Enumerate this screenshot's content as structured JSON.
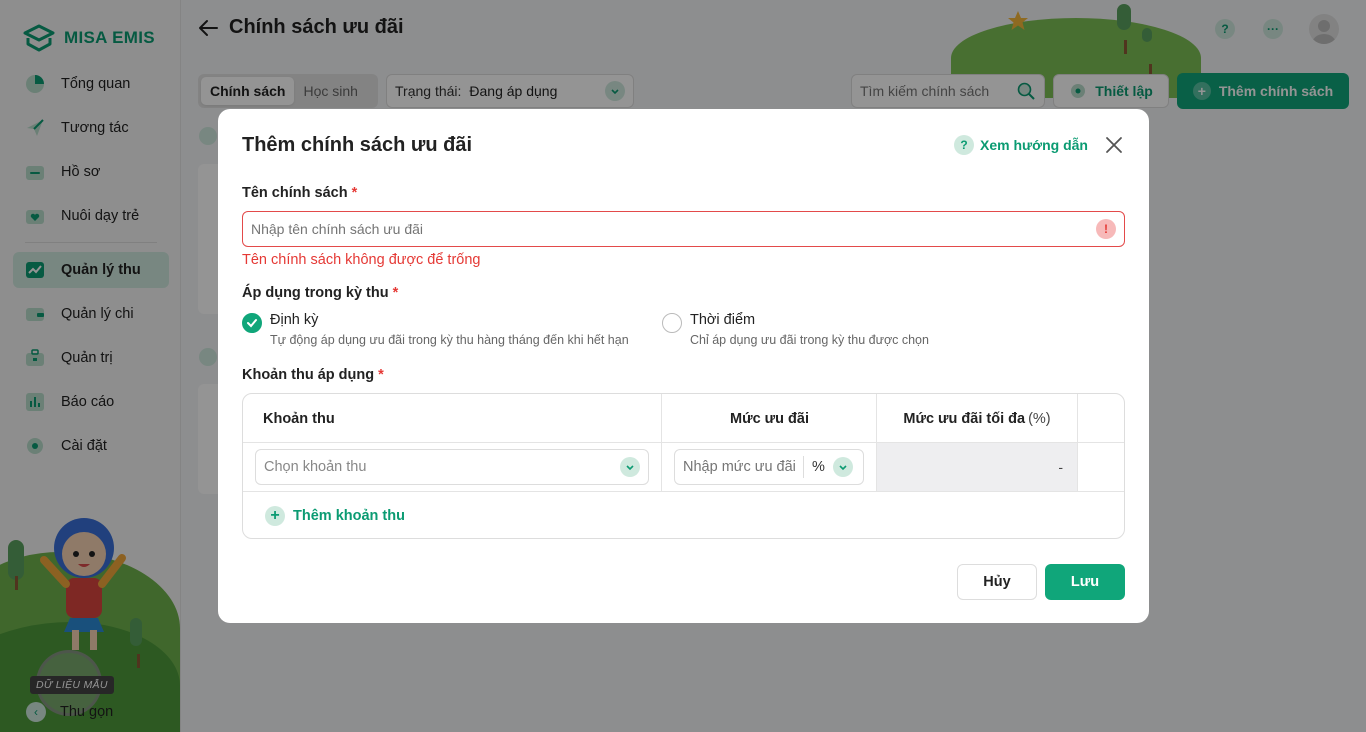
{
  "app": {
    "brand": "MISA EMIS"
  },
  "sidebar": {
    "items": [
      {
        "label": "Tổng quan",
        "icon": "pie-chart-icon"
      },
      {
        "label": "Tương tác",
        "icon": "paper-plane-icon"
      },
      {
        "label": "Hồ sơ",
        "icon": "folder-icon"
      },
      {
        "label": "Nuôi dạy trẻ",
        "icon": "heart-folder-icon"
      },
      {
        "label": "Quản lý thu",
        "icon": "trend-chart-icon",
        "active": true
      },
      {
        "label": "Quản lý chi",
        "icon": "wallet-icon"
      },
      {
        "label": "Quản trị",
        "icon": "briefcase-icon"
      },
      {
        "label": "Báo cáo",
        "icon": "bar-chart-icon"
      },
      {
        "label": "Cài đặt",
        "icon": "gear-icon"
      }
    ],
    "sample_badge": "DỮ LIỆU MẪU",
    "collapse_label": "Thu gọn"
  },
  "header": {
    "title": "Chính sách ưu đãi"
  },
  "toolbar": {
    "tabs": [
      "Chính sách",
      "Học sinh"
    ],
    "status_label": "Trạng thái:",
    "status_value": "Đang áp dụng",
    "search_placeholder": "Tìm kiếm chính sách",
    "setup_label": "Thiết lập",
    "add_label": "Thêm chính sách"
  },
  "modal": {
    "title": "Thêm chính sách ưu đãi",
    "help_label": "Xem hướng dẫn",
    "name_label": "Tên chính sách",
    "name_placeholder": "Nhập tên chính sách ưu đãi",
    "name_error": "Tên chính sách không được để trống",
    "period_label": "Áp dụng trong kỳ thu",
    "options": [
      {
        "title": "Định kỳ",
        "desc": "Tự động áp dụng ưu đãi trong kỳ thu hàng tháng đến khi hết hạn",
        "checked": true
      },
      {
        "title": "Thời điểm",
        "desc": "Chỉ áp dụng ưu đãi trong kỳ thu được chọn",
        "checked": false
      }
    ],
    "fees_label": "Khoản thu áp dụng",
    "table": {
      "col_fee": "Khoản thu",
      "col_rate": "Mức ưu đãi",
      "col_max": "Mức ưu đãi tối đa",
      "col_max_unit": "(%)",
      "fee_placeholder": "Chọn khoản thu",
      "rate_placeholder": "Nhập mức ưu đãi",
      "rate_unit": "%",
      "max_value": "-"
    },
    "add_fee_label": "Thêm khoản thu",
    "cancel_label": "Hủy",
    "save_label": "Lưu"
  },
  "colors": {
    "accent": "#10a67a",
    "accent_light": "#cfe9de",
    "error": "#e53935"
  }
}
